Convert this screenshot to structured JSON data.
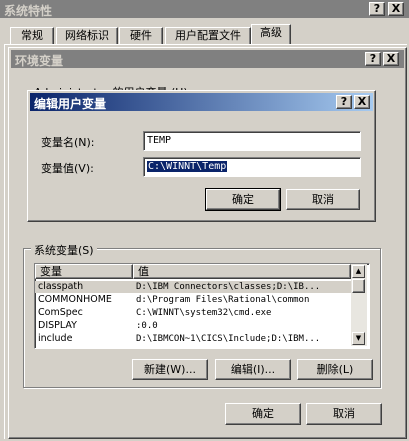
{
  "outer_window": {
    "title": "系统特性",
    "caption_buttons": [
      "?",
      "X"
    ]
  },
  "tabs": [
    "常规",
    "网络标识",
    "硬件",
    "用户配置文件",
    "高级"
  ],
  "env_dialog": {
    "title": "环境变量",
    "caption_buttons": [
      "?",
      "X"
    ],
    "user_vars_label_partial": "Administrator 的用户变量 (U)"
  },
  "edit_dialog": {
    "title": "编辑用户变量",
    "caption_buttons": [
      "?",
      "X"
    ],
    "name_label": "变量名(N):",
    "value_label": "变量值(V):",
    "name_value": "TEMP",
    "value_value": "C:\\WINNT\\Temp",
    "ok": "确定",
    "cancel": "取消"
  },
  "system_vars": {
    "group_label": "系统变量(S)",
    "columns": [
      "变量",
      "值"
    ],
    "rows": [
      {
        "name": "classpath",
        "value": "D:\\IBM Connectors\\classes;D:\\IB..."
      },
      {
        "name": "COMMONHOME",
        "value": "d:\\Program Files\\Rational\\common"
      },
      {
        "name": "ComSpec",
        "value": "C:\\WINNT\\system32\\cmd.exe"
      },
      {
        "name": "DISPLAY",
        "value": ":0.0"
      },
      {
        "name": "include",
        "value": "D:\\IBMCON~1\\CICS\\Include;D:\\IBM..."
      }
    ],
    "new_button": "新建(W)...",
    "edit_button": "编辑(I)...",
    "delete_button": "删除(L)"
  },
  "env_buttons": {
    "ok": "确定",
    "cancel": "取消"
  },
  "icons": {
    "scroll_up": "scroll-up-arrow-icon",
    "scroll_down": "scroll-down-arrow-icon"
  }
}
